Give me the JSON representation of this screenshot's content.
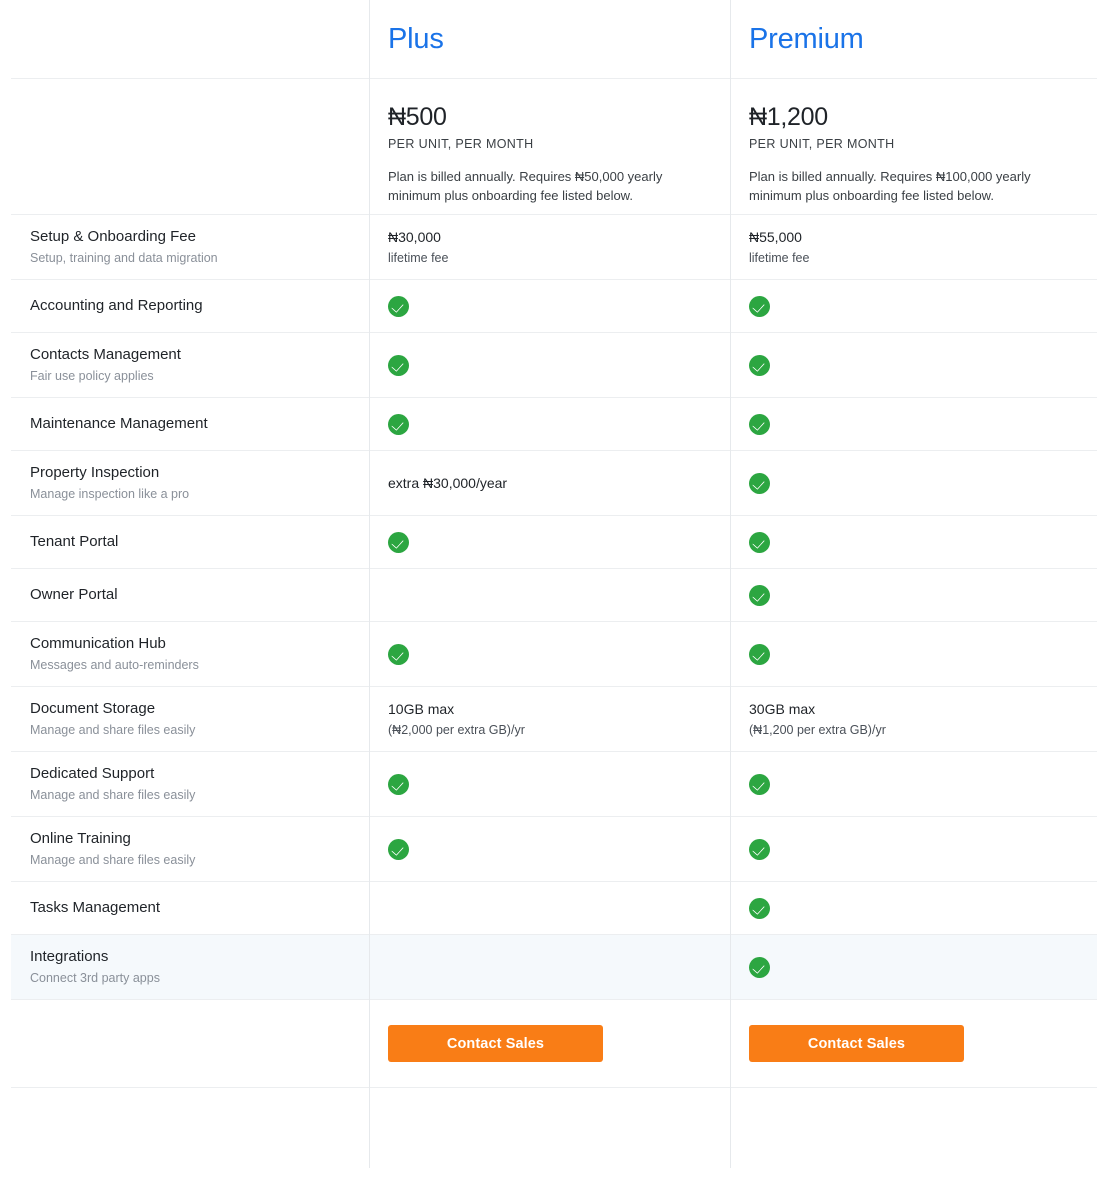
{
  "table": {
    "plans": [
      {
        "name": "Plus",
        "price": "₦500",
        "period": "PER UNIT, PER MONTH",
        "note": "Plan is billed annually. Requires ₦50,000 yearly minimum plus onboarding fee listed below.",
        "cta": "Contact Sales"
      },
      {
        "name": "Premium",
        "price": "₦1,200",
        "period": "PER UNIT, PER MONTH",
        "note": "Plan is billed annually. Requires ₦100,000 yearly minimum plus onboarding fee listed below.",
        "cta": "Contact Sales"
      }
    ],
    "rows": [
      {
        "title": "Setup & Onboarding Fee",
        "subtitle": "Setup, training and data migration",
        "plus": {
          "kind": "text",
          "main": "₦30,000",
          "sub": "lifetime fee"
        },
        "premium": {
          "kind": "text",
          "main": "₦55,000",
          "sub": "lifetime fee"
        }
      },
      {
        "title": "Accounting and Reporting",
        "subtitle": "",
        "plus": {
          "kind": "check"
        },
        "premium": {
          "kind": "check"
        }
      },
      {
        "title": "Contacts Management",
        "subtitle": "Fair use policy applies",
        "plus": {
          "kind": "check"
        },
        "premium": {
          "kind": "check"
        }
      },
      {
        "title": "Maintenance Management",
        "subtitle": "",
        "plus": {
          "kind": "check"
        },
        "premium": {
          "kind": "check"
        }
      },
      {
        "title": "Property Inspection",
        "subtitle": "Manage inspection like a pro",
        "plus": {
          "kind": "text",
          "main": "extra ₦30,000/year",
          "sub": ""
        },
        "premium": {
          "kind": "check"
        }
      },
      {
        "title": "Tenant Portal",
        "subtitle": "",
        "plus": {
          "kind": "check"
        },
        "premium": {
          "kind": "check"
        }
      },
      {
        "title": "Owner Portal",
        "subtitle": "",
        "plus": {
          "kind": "empty"
        },
        "premium": {
          "kind": "check"
        }
      },
      {
        "title": "Communication Hub",
        "subtitle": "Messages and auto-reminders",
        "plus": {
          "kind": "check"
        },
        "premium": {
          "kind": "check"
        }
      },
      {
        "title": "Document Storage",
        "subtitle": "Manage and share files easily",
        "plus": {
          "kind": "text",
          "main": "10GB max",
          "sub": "(₦2,000 per extra GB)/yr"
        },
        "premium": {
          "kind": "text",
          "main": "30GB max",
          "sub": "(₦1,200 per extra GB)/yr"
        }
      },
      {
        "title": "Dedicated Support",
        "subtitle": "Manage and share files easily",
        "plus": {
          "kind": "check"
        },
        "premium": {
          "kind": "check"
        }
      },
      {
        "title": "Online Training",
        "subtitle": "Manage and share files easily",
        "plus": {
          "kind": "check"
        },
        "premium": {
          "kind": "check"
        }
      },
      {
        "title": "Tasks Management",
        "subtitle": "",
        "plus": {
          "kind": "empty"
        },
        "premium": {
          "kind": "check"
        }
      },
      {
        "title": "Integrations",
        "subtitle": "Connect 3rd party apps",
        "highlight": true,
        "plus": {
          "kind": "empty"
        },
        "premium": {
          "kind": "check"
        }
      }
    ]
  },
  "colors": {
    "plan_name": "#1a73e8",
    "check": "#2ca641",
    "cta_background": "#f97d16",
    "cta_text": "#ffffff",
    "highlight_row": "#f5f9fc",
    "rule": "#eceef0"
  },
  "icons": {
    "check": "check-circle-icon"
  }
}
